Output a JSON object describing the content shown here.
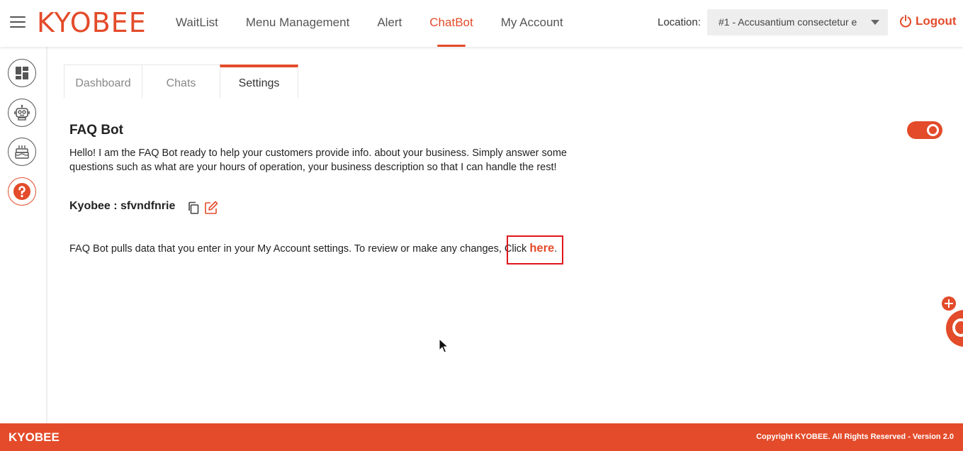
{
  "header": {
    "logo": "KYOBEE",
    "nav": [
      "WaitList",
      "Menu Management",
      "Alert",
      "ChatBot",
      "My Account"
    ],
    "location_label": "Location:",
    "location_value": "#1 - Accusantium consectetur e",
    "logout_label": "Logout"
  },
  "sidebar": {
    "items": [
      "dashboard-icon",
      "robot-icon",
      "cake-icon",
      "help-icon"
    ]
  },
  "tabs": [
    "Dashboard",
    "Chats",
    "Settings"
  ],
  "faq": {
    "title": "FAQ Bot",
    "description": "Hello! I am the FAQ Bot ready to help your customers provide info. about your business. Simply answer some questions such as what are your hours of operation, your business description so that I can handle the rest!",
    "enabled": true,
    "bot_name": "Kyobee : sfvndfnrie",
    "info_text": "FAQ Bot pulls data that you enter in your My Account settings. To review or make any changes, Click ",
    "link_text": "here",
    "info_end": "."
  },
  "footer": {
    "brand": "KYOBEE",
    "copyright": "Copyright KYOBEE. All Rights Reserved - Version 2.0"
  },
  "colors": {
    "accent": "#e34b2a",
    "highlight": "#e0161e"
  }
}
